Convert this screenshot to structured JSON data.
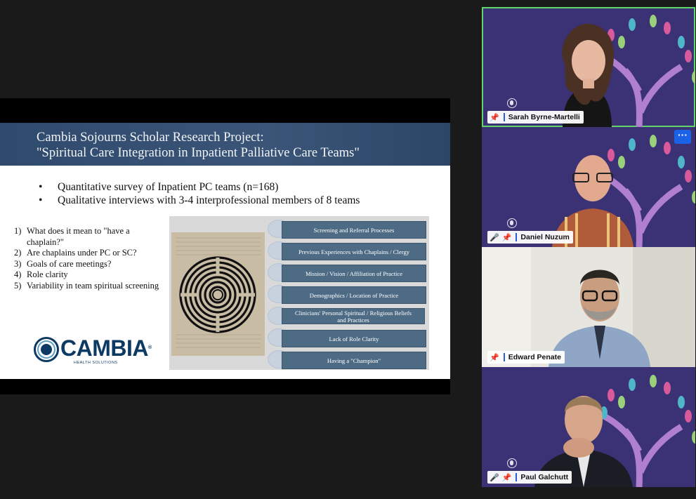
{
  "slide": {
    "title_line1": "Cambia Sojourns Scholar Research Project:",
    "title_line2": "\"Spiritual Care Integration in Inpatient Palliative Care Teams\"",
    "bullets": [
      "Quantitative survey of Inpatient PC teams (n=168)",
      "Qualitative interviews with 3-4 interprofessional members of 8 teams"
    ],
    "questions": [
      {
        "num": "1)",
        "text": "What does it mean to \"have a chaplain?\""
      },
      {
        "num": "2)",
        "text": "Are chaplains under PC or SC?"
      },
      {
        "num": "3)",
        "text": "Goals of care meetings?"
      },
      {
        "num": "4)",
        "text": "Role clarity"
      },
      {
        "num": "5)",
        "text": "Variability in team spiritual screening"
      }
    ],
    "logo": {
      "word": "CAMBIA",
      "sub": "HEALTH SOLUTIONS",
      "reg": "®"
    },
    "factors": [
      "Screening and Referral Processes",
      "Previous Experiences with Chaplains / Clergy",
      "Mission / Vision / Affiliation of Practice",
      "Demographics / Location of Practice",
      "Clinicians' Personal Spiritual / Religious Beliefs and Practices",
      "Lack of Role Clarity",
      "Having a \"Champion\""
    ]
  },
  "participants": [
    {
      "name": "Sarah Byrne-Martelli",
      "active": true,
      "muted": false,
      "pinned": true
    },
    {
      "name": "Daniel Nuzum",
      "active": false,
      "muted": true,
      "pinned": true,
      "more_label": "···"
    },
    {
      "name": "Edward Penate",
      "active": false,
      "muted": false,
      "pinned": true
    },
    {
      "name": "Paul  Galchutt",
      "active": false,
      "muted": true,
      "pinned": true
    }
  ],
  "icons": [
    "pin-icon",
    "mic-off-icon",
    "audio-icon",
    "more-options-icon",
    "labyrinth-image"
  ],
  "colors": {
    "active_speaker": "#61d46b",
    "slide_header": "#2f4a6d",
    "factor_bar": "#4e6b85",
    "tile_bg": "#3b3276",
    "button_blue": "#1b62e6"
  }
}
